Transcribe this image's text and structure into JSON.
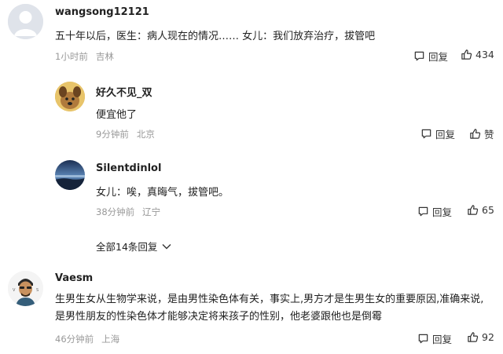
{
  "comments": [
    {
      "username": "wangsong12121",
      "text": "五十年以后，医生：病人现在的情况…… 女儿：我们放弃治疗，拔管吧",
      "time": "1小时前",
      "location": "吉林",
      "reply_label": "回复",
      "like_count": "434"
    },
    {
      "username": "好久不见_双",
      "text": "便宜他了",
      "time": "9分钟前",
      "location": "北京",
      "reply_label": "回复",
      "like_count": "赞"
    },
    {
      "username": "Silentdinlol",
      "text": "女儿：唉，真晦气，拔管吧。",
      "time": "38分钟前",
      "location": "辽宁",
      "reply_label": "回复",
      "like_count": "65"
    },
    {
      "username": "Vaesm",
      "text_line1": "生男生女从生物学来说，是由男性染色体有关，事实上,男方才是生男生女的重要原因,准确来说,",
      "text_line2": "是男性朋友的性染色体才能够决定将来孩子的性别，他老婆跟他也是倒霉",
      "time": "46分钟前",
      "location": "上海",
      "reply_label": "回复",
      "like_count": "92"
    }
  ],
  "expand_replies_label": "全部14条回复",
  "icons": {
    "reply": "comment-bubble-icon",
    "like": "thumbs-up-icon",
    "expand": "chevron-down-icon"
  },
  "colors": {
    "text": "#222222",
    "meta": "#999999",
    "icon": "#333333"
  }
}
